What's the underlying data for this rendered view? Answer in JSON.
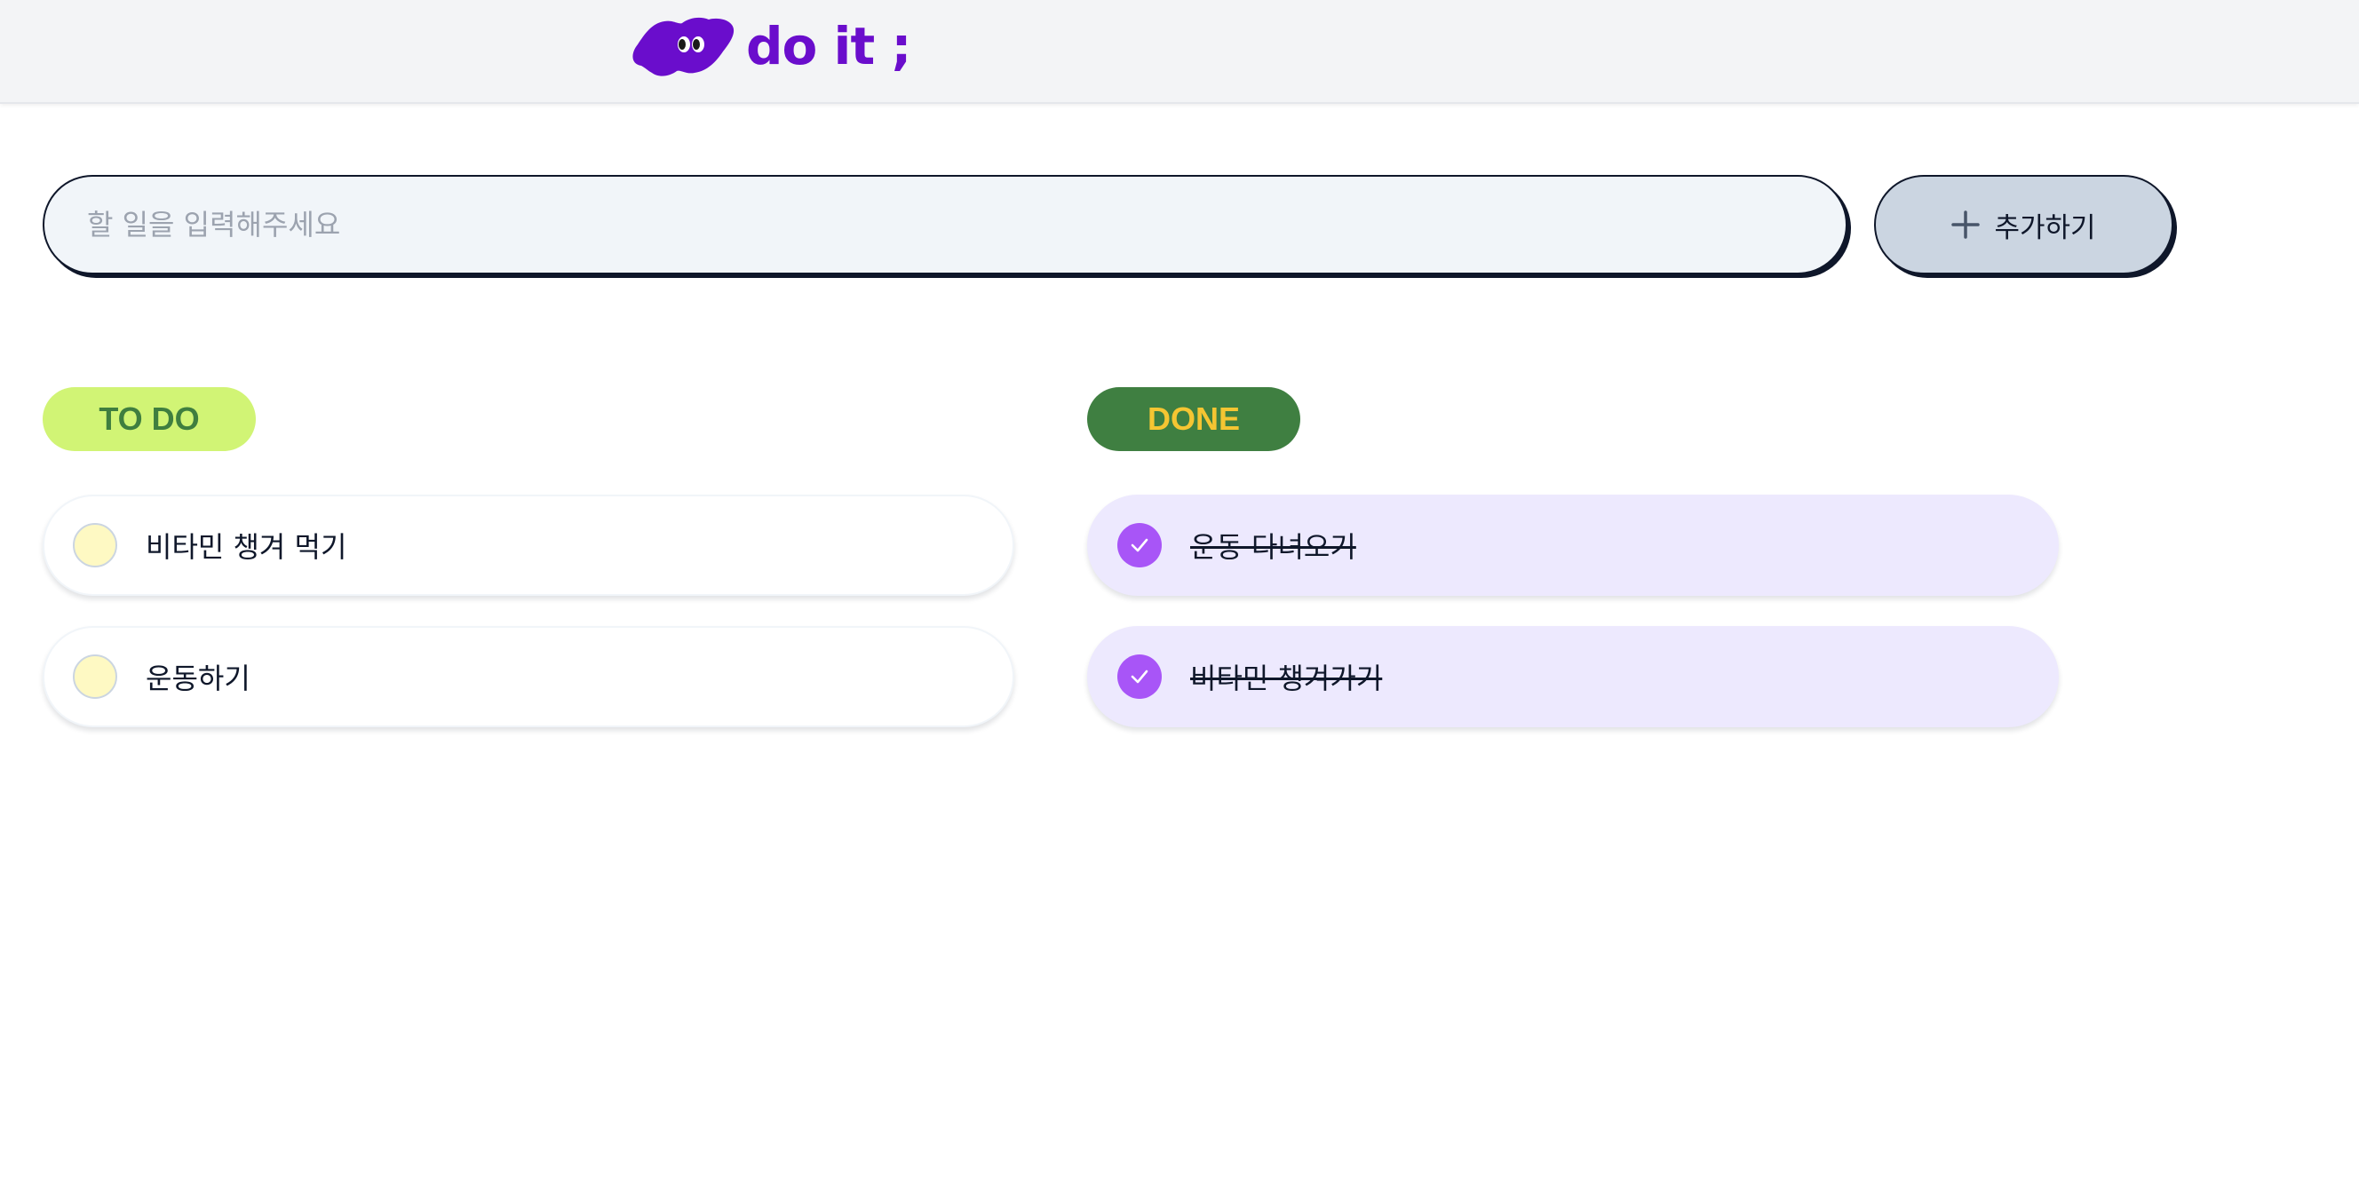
{
  "header": {
    "logo_text": "do it ;",
    "brand_color": "#6a0dcc"
  },
  "todo_input": {
    "placeholder": "할 일을 입력해주세요",
    "value": ""
  },
  "add_button": {
    "icon": "plus-icon",
    "label": "추가하기"
  },
  "todo_section": {
    "title": "TO DO",
    "badge_bg": "#d1f475",
    "badge_fg": "#3f7e3f",
    "items": [
      {
        "text": "비타민 챙겨 먹기",
        "done": false
      },
      {
        "text": "운동하기",
        "done": false
      }
    ]
  },
  "done_section": {
    "title": "DONE",
    "badge_bg": "#3f7f41",
    "badge_fg": "#f5c532",
    "items": [
      {
        "text": "운동 다녀오기",
        "done": true
      },
      {
        "text": "비타민 챙겨가기",
        "done": true
      }
    ]
  },
  "colors": {
    "check_purple": "#a855f7",
    "unchecked_fill": "#fef9c3",
    "done_item_bg": "#ede9fe"
  }
}
